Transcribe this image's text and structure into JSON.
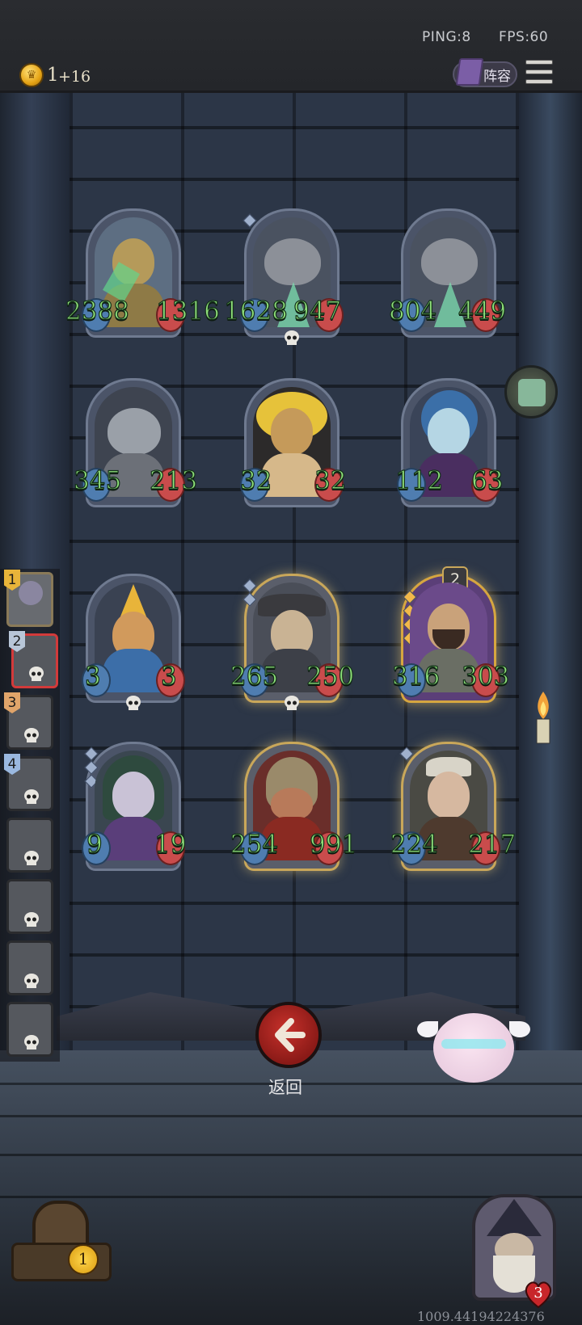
{
  "status": {
    "ping": "PING:8",
    "fps": "FPS:60"
  },
  "currency": {
    "gold": "1",
    "gold_income": "+16"
  },
  "header": {
    "lineup_label": "阵容"
  },
  "board": {
    "row1": [
      {
        "name": "robot",
        "atk": "2388",
        "hp": "1316"
      },
      {
        "name": "shark-dragon",
        "atk": "1628",
        "hp": "947"
      },
      {
        "name": "shark-dragon",
        "atk": "804",
        "hp": "449"
      }
    ],
    "row2": [
      {
        "name": "horned-beast",
        "atk": "345",
        "hp": "213"
      },
      {
        "name": "golden-mummy",
        "atk": "32",
        "hp": "32"
      },
      {
        "name": "blue-elf",
        "atk": "112",
        "hp": "63"
      }
    ],
    "row3": [
      {
        "name": "pinocchio",
        "atk": "3",
        "hp": "3"
      },
      {
        "name": "hat-man",
        "atk": "265",
        "hp": "250"
      },
      {
        "name": "bearded-knight",
        "atk": "316",
        "hp": "303",
        "level": "2"
      }
    ],
    "row4": [
      {
        "name": "red-eye-elf",
        "atk": "9",
        "hp": "19"
      },
      {
        "name": "helmet-warrior",
        "atk": "254",
        "hp": "991"
      },
      {
        "name": "girl-smith",
        "atk": "224",
        "hp": "217"
      }
    ]
  },
  "queue": [
    "1",
    "2",
    "3",
    "4"
  ],
  "controls": {
    "return_label": "返回"
  },
  "shop": {
    "level": "1"
  },
  "hero": {
    "health": "3"
  },
  "coords": "1009.44194224376",
  "colors": {
    "stat_text": "#8fe07a",
    "return_red": "#c7312b",
    "gold_frame": "#c9a75a"
  }
}
